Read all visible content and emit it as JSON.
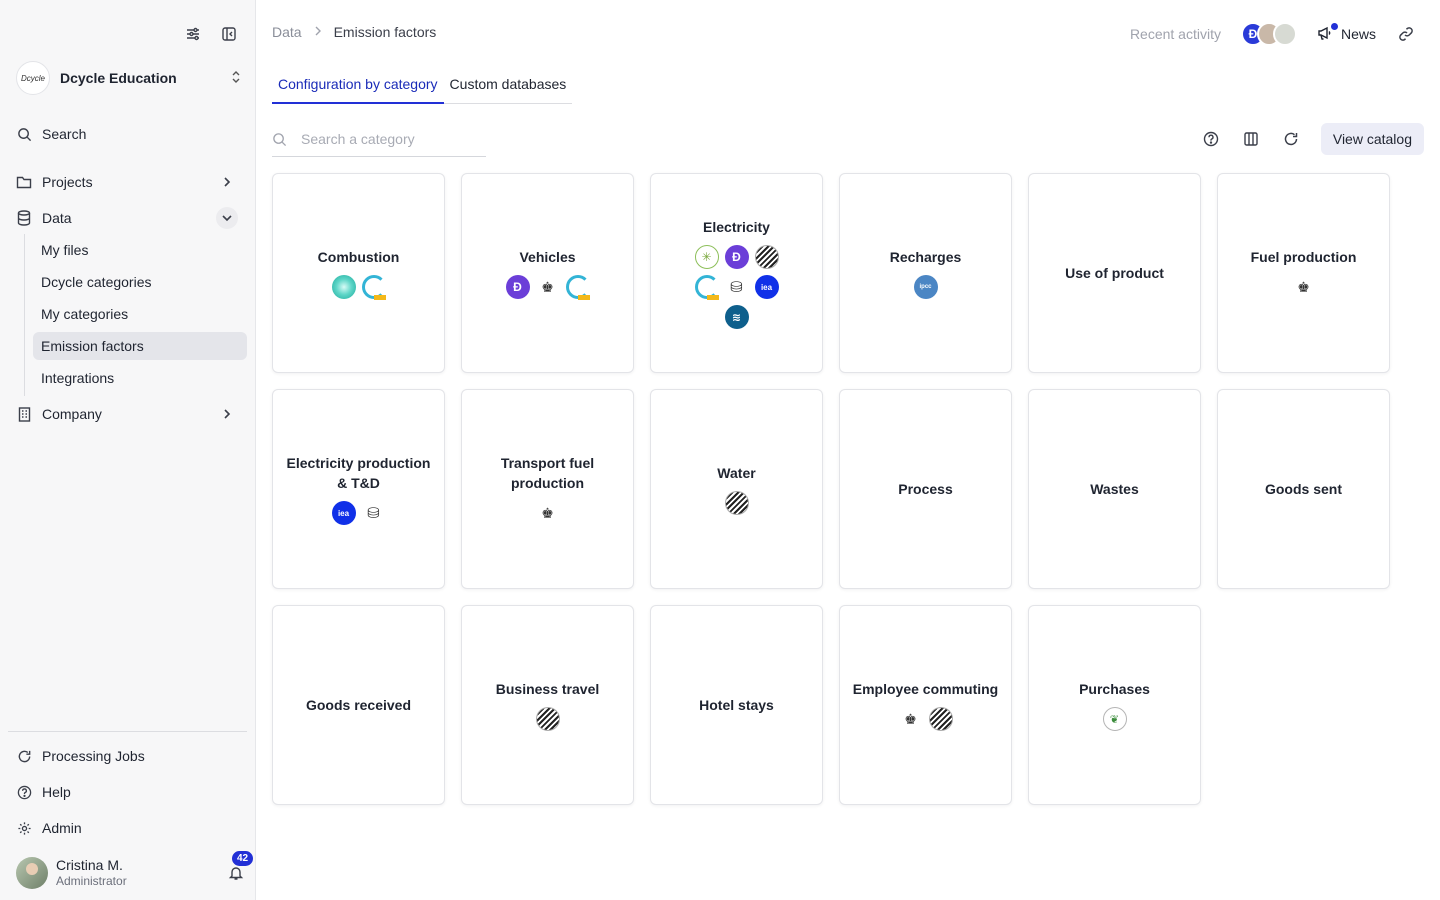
{
  "sidebar": {
    "org_name": "Dcycle Education",
    "org_logo_text": "Dcycle",
    "search_label": "Search",
    "nav": {
      "projects": "Projects",
      "data": "Data",
      "company": "Company"
    },
    "data_sub": [
      "My files",
      "Dcycle categories",
      "My categories",
      "Emission factors",
      "Integrations"
    ],
    "active_sub": "Emission factors",
    "bottom": {
      "processing_jobs": "Processing Jobs",
      "help": "Help",
      "admin": "Admin"
    },
    "user": {
      "name": "Cristina M.",
      "role": "Administrator",
      "notification_count": "42"
    }
  },
  "header": {
    "breadcrumb_root": "Data",
    "breadcrumb_current": "Emission factors",
    "recent_activity": "Recent activity",
    "news": "News"
  },
  "tabs": [
    "Configuration by category",
    "Custom databases"
  ],
  "active_tab": "Configuration by category",
  "search": {
    "placeholder": "Search a category"
  },
  "toolbar": {
    "view_catalog": "View catalog"
  },
  "accent_color": "#2230d6",
  "categories": [
    {
      "title": "Combustion",
      "logos": [
        "teal",
        "ring"
      ]
    },
    {
      "title": "Vehicles",
      "logos": [
        "dcycle",
        "crest",
        "ring"
      ]
    },
    {
      "title": "Electricity",
      "logos": [
        "sun",
        "dcycle",
        "stripe",
        "ring",
        "db",
        "iea",
        "ocean"
      ]
    },
    {
      "title": "Recharges",
      "logos": [
        "ipcc"
      ]
    },
    {
      "title": "Use of product",
      "logos": []
    },
    {
      "title": "Fuel production",
      "logos": [
        "crest"
      ]
    },
    {
      "title": "Electricity production & T&D",
      "logos": [
        "iea",
        "db"
      ]
    },
    {
      "title": "Transport fuel production",
      "logos": [
        "crest"
      ]
    },
    {
      "title": "Water",
      "logos": [
        "stripe"
      ]
    },
    {
      "title": "Process",
      "logos": []
    },
    {
      "title": "Wastes",
      "logos": []
    },
    {
      "title": "Goods sent",
      "logos": []
    },
    {
      "title": "Goods received",
      "logos": []
    },
    {
      "title": "Business travel",
      "logos": [
        "stripe"
      ]
    },
    {
      "title": "Hotel stays",
      "logos": []
    },
    {
      "title": "Employee commuting",
      "logos": [
        "crest",
        "stripe"
      ]
    },
    {
      "title": "Purchases",
      "logos": [
        "leaf"
      ]
    }
  ]
}
